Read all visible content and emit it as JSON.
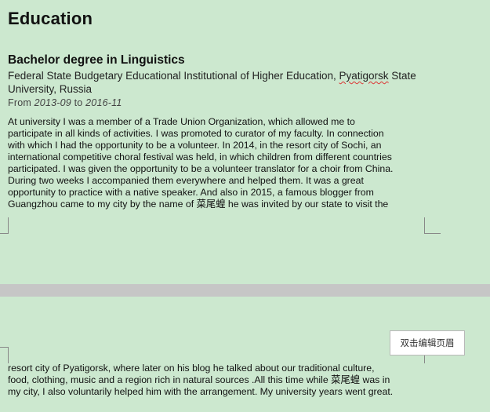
{
  "section": {
    "heading": "Education"
  },
  "education": {
    "degree": "Bachelor degree in Linguistics",
    "institution_main": "Federal State Budgetary Educational Institutional of Higher Education, ",
    "institution_city": "Pyatigorsk",
    "institution_rest": " State University, Russia",
    "dates": {
      "from_label": "From",
      "start": "2013-09",
      "to_label": "to",
      "end": "2016-11"
    }
  },
  "description": {
    "page1_lines": [
      "At university I was a member of a Trade Union Organization, which allowed me to",
      "participate in all kinds of activities. I was promoted to curator of my faculty. In connection",
      "with which I had the opportunity to be a volunteer. In 2014, in the resort city of Sochi, an",
      "international competitive choral festival was held, in which children from different countries",
      "participated.  I was given the opportunity to be a volunteer translator for a choir from China.",
      "During two weeks I accompanied them everywhere and helped them.  It was a great",
      "opportunity to practice with a native speaker. And also in 2015, a famous blogger from",
      "Guangzhou came to my city by the name of 菜尾蝗 he was invited by our state to visit the"
    ],
    "page2_lines": [
      "resort city of Pyatigorsk, where later on his blog he talked about our traditional culture,",
      "food, clothing, music and a region rich in natural sources  .All this time while 菜尾蝗 was in",
      "my city, I also voluntarily helped him with the arrangement. My university years went great."
    ]
  },
  "header_edit_button": {
    "label": "双击编辑页眉"
  }
}
